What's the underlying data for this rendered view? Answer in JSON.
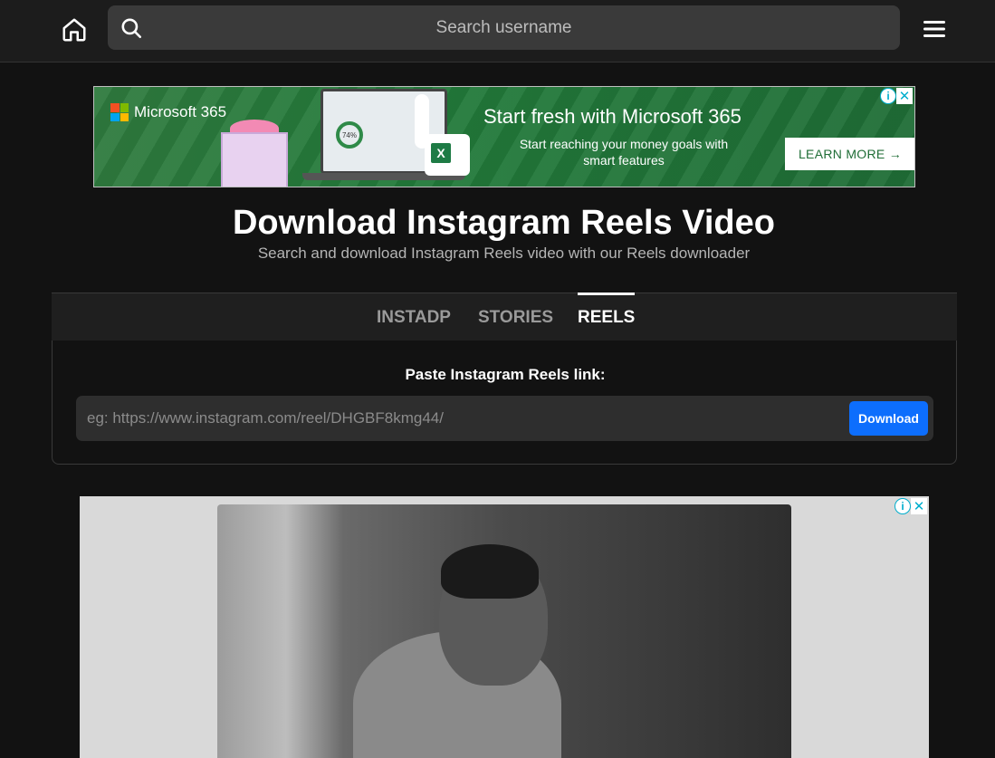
{
  "topbar": {
    "home_icon": "home-icon",
    "search_icon": "search-icon",
    "search_placeholder": "Search username",
    "menu_icon": "hamburger-menu-icon"
  },
  "ad_top": {
    "brand": "Microsoft 365",
    "ring_value": "74%",
    "headline": "Start fresh with Microsoft 365",
    "subline": "Start reaching your money goals with smart features",
    "cta": "LEARN MORE →",
    "info_glyph": "i",
    "close_glyph": "✕",
    "logo_colors": [
      "#f25022",
      "#7fba00",
      "#00a4ef",
      "#ffb900"
    ]
  },
  "heading": {
    "title": "Download Instagram Reels Video",
    "subtitle": "Search and download Instagram Reels video with our Reels downloader"
  },
  "tabs": [
    {
      "label": "INSTADP",
      "active": false
    },
    {
      "label": "STORIES",
      "active": false
    },
    {
      "label": "REELS",
      "active": true
    }
  ],
  "form": {
    "label": "Paste Instagram Reels link:",
    "placeholder": "eg: https://www.instagram.com/reel/DHGBF8kmg44/",
    "button": "Download"
  },
  "ad_video": {
    "info_glyph": "i",
    "close_glyph": "✕"
  },
  "colors": {
    "background": "#121212",
    "topbar": "#1c1c1c",
    "accent_button": "#0d6efd",
    "ad_green": "#227a3a"
  }
}
